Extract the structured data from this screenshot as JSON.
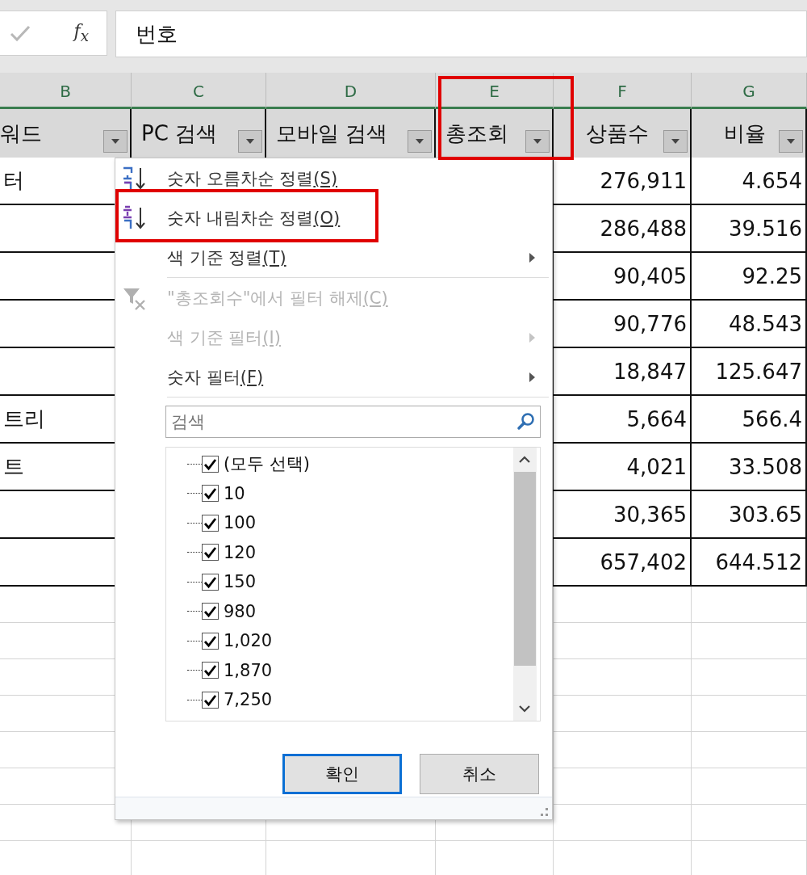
{
  "formula_bar": {
    "function_label": "f$_{x}$",
    "value": "번호"
  },
  "column_headers": [
    "B",
    "C",
    "D",
    "E",
    "F",
    "G"
  ],
  "header_row": [
    {
      "label": "워드",
      "highlighted": false
    },
    {
      "label": "PC 검색",
      "highlighted": false
    },
    {
      "label": "모바일 검색",
      "highlighted": false
    },
    {
      "label": "총조회",
      "highlighted": true
    },
    {
      "label": "상품수",
      "highlighted": false
    },
    {
      "label": "비율",
      "highlighted": false
    }
  ],
  "rows": [
    {
      "cells": [
        "터",
        "276,911",
        "4.654"
      ]
    },
    {
      "cells": [
        "",
        "286,488",
        "39.516"
      ]
    },
    {
      "cells": [
        "",
        "90,405",
        "92.25"
      ]
    },
    {
      "cells": [
        "",
        "90,776",
        "48.543"
      ]
    },
    {
      "cells": [
        "",
        "18,847",
        "125.647"
      ]
    },
    {
      "cells": [
        "트리",
        "5,664",
        "566.4"
      ]
    },
    {
      "cells": [
        "트",
        "4,021",
        "33.508"
      ]
    },
    {
      "cells": [
        "",
        "30,365",
        "303.65"
      ]
    },
    {
      "cells": [
        "",
        "657,402",
        "644.512"
      ]
    }
  ],
  "filter_menu": {
    "items": [
      {
        "label": "숫자 오름차순 정렬",
        "shortcut": "(S)",
        "kind": "sort_ascending",
        "disabled": false,
        "submenu": false,
        "highlighted": false,
        "separator_after": false
      },
      {
        "label": "숫자 내림차순 정렬",
        "shortcut": "(O)",
        "kind": "sort_descending",
        "disabled": false,
        "submenu": false,
        "highlighted": true,
        "separator_after": false
      },
      {
        "label": "색 기준 정렬",
        "shortcut": "(T)",
        "kind": "plain",
        "disabled": false,
        "submenu": true,
        "highlighted": false,
        "separator_after": true
      },
      {
        "label": "\"총조회수\"에서 필터 해제",
        "shortcut": "(C)",
        "kind": "clear_filter",
        "disabled": true,
        "submenu": false,
        "highlighted": false,
        "separator_after": false
      },
      {
        "label": "색 기준 필터",
        "shortcut": "(I)",
        "kind": "plain",
        "disabled": true,
        "submenu": true,
        "highlighted": false,
        "separator_after": false
      },
      {
        "label": "숫자 필터",
        "shortcut": "(F)",
        "kind": "plain",
        "disabled": false,
        "submenu": true,
        "highlighted": false,
        "separator_after": true
      }
    ],
    "search": {
      "placeholder": "검색"
    },
    "values": [
      {
        "label": "(모두 선택)",
        "checked": true
      },
      {
        "label": "10",
        "checked": true
      },
      {
        "label": "100",
        "checked": true
      },
      {
        "label": "120",
        "checked": true
      },
      {
        "label": "150",
        "checked": true
      },
      {
        "label": "980",
        "checked": true
      },
      {
        "label": "1,020",
        "checked": true
      },
      {
        "label": "1,870",
        "checked": true
      },
      {
        "label": "7,250",
        "checked": true
      }
    ],
    "buttons": [
      {
        "label": "확인",
        "focused": true
      },
      {
        "label": "취소",
        "focused": false
      }
    ]
  }
}
